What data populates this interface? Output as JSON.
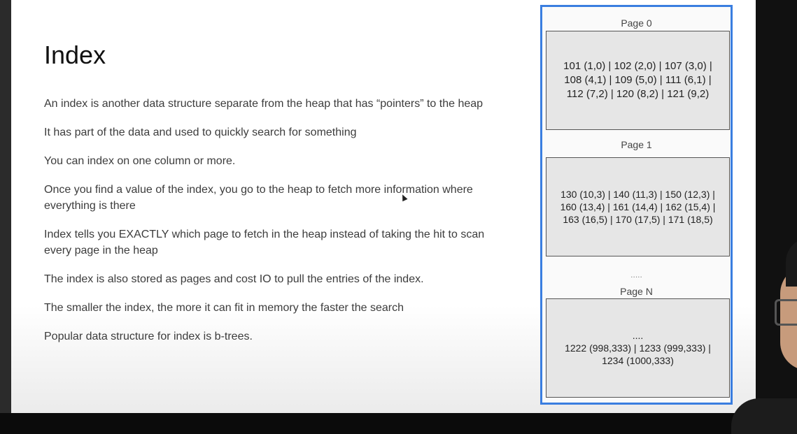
{
  "slide": {
    "title": "Index",
    "bullets": [
      "An index is another data structure separate from the heap that has “pointers” to the heap",
      "It has part of the data and used to quickly search for something",
      "You can index on one column or more.",
      "Once you find a value of the index, you go to the heap to fetch more information where everything is there",
      "Index tells you EXACTLY which page to fetch in the heap instead of taking the hit to scan every page in the heap",
      "The index is also stored as pages and cost IO to pull the entries of the index.",
      "The smaller the index, the more it can fit in memory the faster the search",
      "Popular data structure for index is b-trees."
    ]
  },
  "heap": {
    "pages": [
      {
        "label": "Page 0",
        "lines": [
          "101 (1,0) | 102 (2,0) | 107 (3,0) |",
          "108 (4,1) | 109 (5,0) | 111 (6,1) |",
          "112 (7,2) | 120 (8,2) | 121 (9,2)"
        ]
      },
      {
        "label": "Page 1",
        "lines": [
          "130 (10,3) | 140 (11,3) | 150 (12,3) |",
          "160 (13,4) | 161 (14,4) | 162 (15,4) |",
          "163 (16,5) | 170 (17,5) | 171 (18,5)"
        ]
      },
      {
        "label": "Page N",
        "lines": [
          "....",
          "1222 (998,333) | 1233 (999,333) |",
          "1234 (1000,333)"
        ]
      }
    ],
    "ellipsis": "....."
  }
}
